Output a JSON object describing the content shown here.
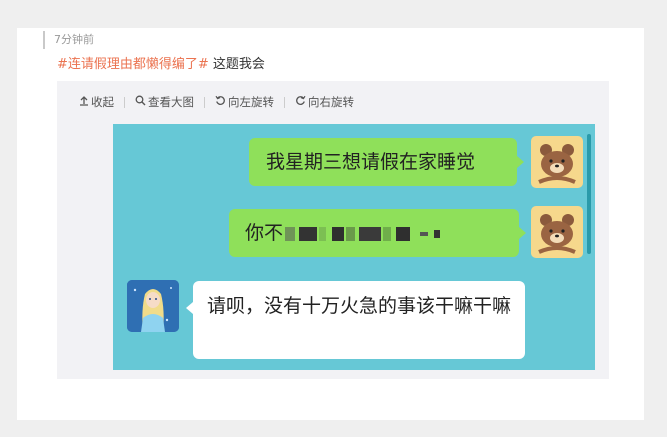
{
  "post": {
    "timestamp": "7分钟前",
    "hashtag": "#连请假理由都懒得编了#",
    "text": " 这题我会"
  },
  "toolbar": {
    "collapse": {
      "icon": "collapse-arrow-icon",
      "label": "收起"
    },
    "zoom": {
      "icon": "magnifier-icon",
      "label": "查看大图"
    },
    "rotate_left": {
      "icon": "rotate-left-icon",
      "label": "向左旋转"
    },
    "rotate_right": {
      "icon": "rotate-right-icon",
      "label": "向右旋转"
    }
  },
  "chat": {
    "background": "#66c8d6",
    "messages": [
      {
        "side": "right",
        "avatar": "brown-bear-icon",
        "bubble_color": "#8fe05a",
        "text": "我星期三想请假在家睡觉"
      },
      {
        "side": "right",
        "avatar": "brown-bear-icon",
        "bubble_color": "#8fe05a",
        "text": "你不",
        "censored": true
      },
      {
        "side": "left",
        "avatar": "ice-princess-avatar",
        "bubble_color": "#ffffff",
        "text": "请呗，没有十万火急的事该干嘛干嘛"
      }
    ]
  },
  "colors": {
    "hashtag": "#eb7350",
    "page_background": "#efefef",
    "media_background": "#f2f2f5"
  }
}
